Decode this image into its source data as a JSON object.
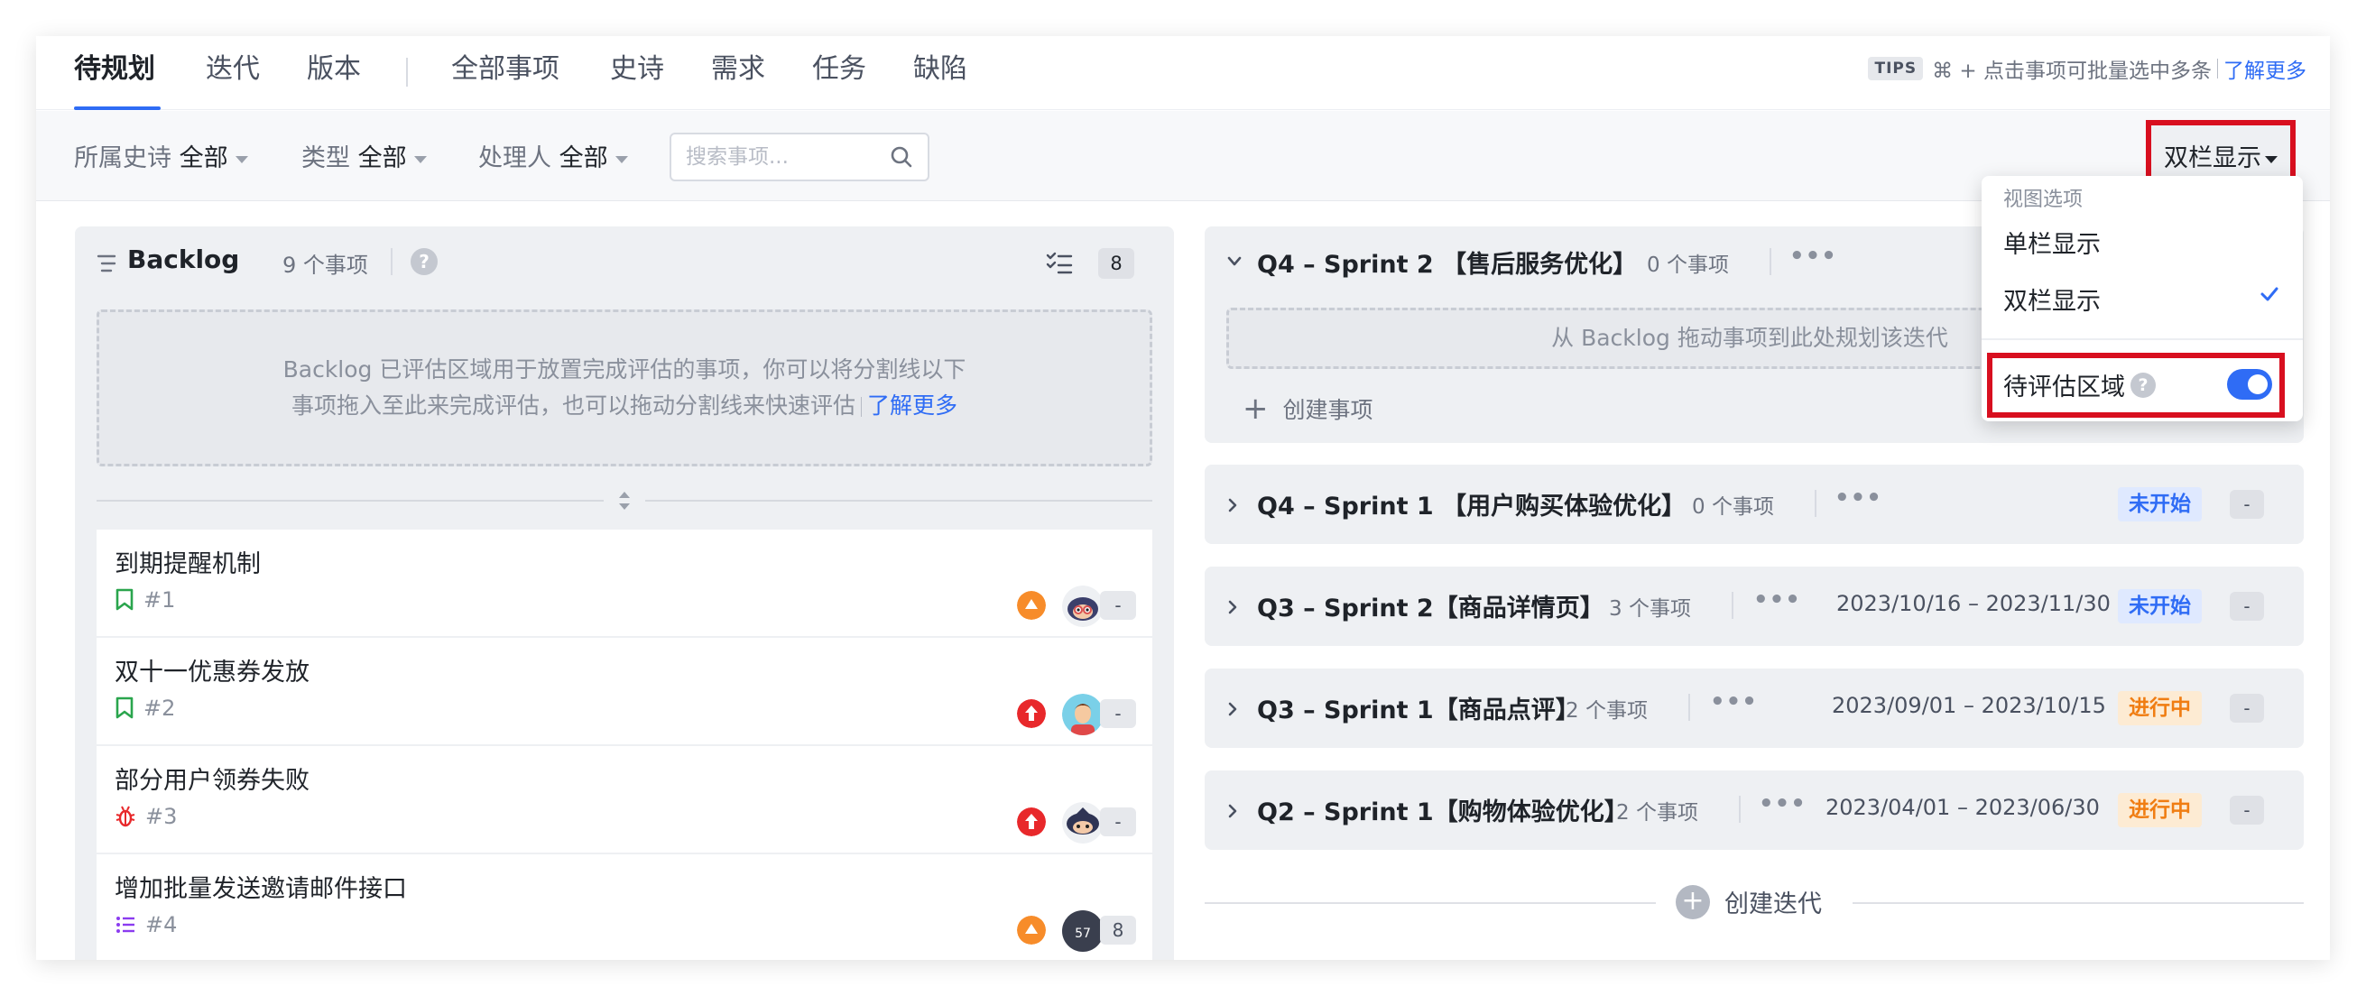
{
  "nav": {
    "tabs": [
      "待规划",
      "迭代",
      "版本",
      "全部事项",
      "史诗",
      "需求",
      "任务",
      "缺陷"
    ],
    "tips": {
      "badge": "TIPS",
      "text": "⌘ + 点击事项可批量选中多条",
      "link": "了解更多"
    }
  },
  "filters": {
    "epic": {
      "label": "所属史诗",
      "value": "全部"
    },
    "type": {
      "label": "类型",
      "value": "全部"
    },
    "assignee": {
      "label": "处理人",
      "value": "全部"
    },
    "search_placeholder": "搜索事项...",
    "view_button": "双栏显示"
  },
  "backlog": {
    "title": "Backlog",
    "count": "9 个事项",
    "badge": "8",
    "help": "?",
    "dropzone_line1": "Backlog 已评估区域用于放置完成评估的事项，你可以将分割线以下",
    "dropzone_line2": "事项拖入至此来完成评估，也可以拖动分割线来快速评估",
    "dropzone_link": "了解更多",
    "issues": [
      {
        "title": "到期提醒机制",
        "id": "#1",
        "type": "story",
        "priority": "medium",
        "estimate": "-"
      },
      {
        "title": "双十一优惠券发放",
        "id": "#2",
        "type": "story",
        "priority": "high",
        "estimate": "-"
      },
      {
        "title": "部分用户领券失败",
        "id": "#3",
        "type": "bug",
        "priority": "high",
        "estimate": "-"
      },
      {
        "title": "增加批量发送邀请邮件接口",
        "id": "#4",
        "type": "task",
        "priority": "medium",
        "estimate": "8",
        "avatar_text": "57"
      }
    ]
  },
  "sprints": [
    {
      "title": "Q4 – Sprint 2 【售后服务优化】",
      "count": "0 个事项",
      "more": "•••",
      "drop_text": "从 Backlog 拖动事项到此处规划该迭代",
      "create_label": "创建事项"
    },
    {
      "title": "Q4 – Sprint 1 【用户购买体验优化】",
      "count": "0 个事项",
      "more": "•••",
      "status": "未开始",
      "dash": "-"
    },
    {
      "title": "Q3 – Sprint 2【商品详情页】",
      "count": "3 个事项",
      "more": "•••",
      "date": "2023/10/16 – 2023/11/30",
      "status": "未开始",
      "dash": "-"
    },
    {
      "title": "Q3 – Sprint 1【商品点评】",
      "count": "2 个事项",
      "more": "•••",
      "date": "2023/09/01 – 2023/10/15",
      "status": "进行中",
      "dash": "-"
    },
    {
      "title": "Q2 – Sprint 1【购物体验优化】",
      "count": "2 个事项",
      "more": "•••",
      "date": "2023/04/01 – 2023/06/30",
      "status": "进行中",
      "dash": "-"
    }
  ],
  "create_iteration": {
    "plus": "+",
    "label": "创建迭代"
  },
  "view_menu": {
    "group": "视图选项",
    "single": "单栏显示",
    "double": "双栏显示",
    "pending": "待评估区域",
    "help": "?",
    "toggle_on": true
  },
  "colors": {
    "accent": "#2f6cf5",
    "highlight": "#d80f1f",
    "status_ns": "#2f6cf5",
    "status_ip": "#f07d12"
  }
}
